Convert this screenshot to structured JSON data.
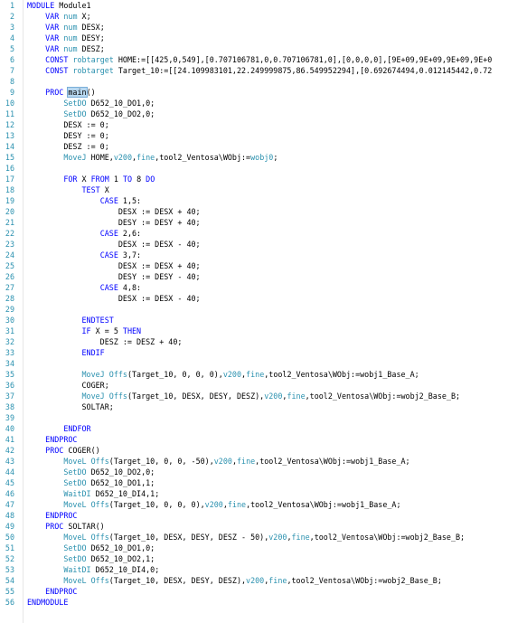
{
  "colors": {
    "background": "#ffffff",
    "line_number": "#2b91af",
    "keyword": "#0000ff",
    "type": "#2b91af",
    "instruction": "#2b91af",
    "plain": "#000000",
    "highlight": "#b8d8f0"
  },
  "lines": [
    {
      "n": "1",
      "tokens": [
        {
          "t": "MODULE",
          "c": "keyword"
        },
        {
          "t": " Module1",
          "c": "plain"
        }
      ]
    },
    {
      "n": "2",
      "tokens": [
        {
          "t": "    ",
          "c": "plain"
        },
        {
          "t": "VAR",
          "c": "keyword"
        },
        {
          "t": " ",
          "c": "plain"
        },
        {
          "t": "num",
          "c": "type"
        },
        {
          "t": " X;",
          "c": "plain"
        }
      ]
    },
    {
      "n": "3",
      "tokens": [
        {
          "t": "    ",
          "c": "plain"
        },
        {
          "t": "VAR",
          "c": "keyword"
        },
        {
          "t": " ",
          "c": "plain"
        },
        {
          "t": "num",
          "c": "type"
        },
        {
          "t": " DESX;",
          "c": "plain"
        }
      ]
    },
    {
      "n": "4",
      "tokens": [
        {
          "t": "    ",
          "c": "plain"
        },
        {
          "t": "VAR",
          "c": "keyword"
        },
        {
          "t": " ",
          "c": "plain"
        },
        {
          "t": "num",
          "c": "type"
        },
        {
          "t": " DESY;",
          "c": "plain"
        }
      ]
    },
    {
      "n": "5",
      "tokens": [
        {
          "t": "    ",
          "c": "plain"
        },
        {
          "t": "VAR",
          "c": "keyword"
        },
        {
          "t": " ",
          "c": "plain"
        },
        {
          "t": "num",
          "c": "type"
        },
        {
          "t": " DESZ;",
          "c": "plain"
        }
      ]
    },
    {
      "n": "6",
      "tokens": [
        {
          "t": "    ",
          "c": "plain"
        },
        {
          "t": "CONST",
          "c": "keyword"
        },
        {
          "t": " ",
          "c": "plain"
        },
        {
          "t": "robtarget",
          "c": "type"
        },
        {
          "t": " HOME:=[[425,0,549],[0.707106781,0,0.707106781,0],[0,0,0,0],[9E+09,9E+09,9E+09,9E+0",
          "c": "plain"
        }
      ]
    },
    {
      "n": "7",
      "tokens": [
        {
          "t": "    ",
          "c": "plain"
        },
        {
          "t": "CONST",
          "c": "keyword"
        },
        {
          "t": " ",
          "c": "plain"
        },
        {
          "t": "robtarget",
          "c": "type"
        },
        {
          "t": " Target_10:=[[24.109983101,22.249999875,86.549952294],[0.692674494,0.012145442,0.72",
          "c": "plain"
        }
      ]
    },
    {
      "n": "8",
      "tokens": []
    },
    {
      "n": "9",
      "tokens": [
        {
          "t": "    ",
          "c": "plain"
        },
        {
          "t": "PROC",
          "c": "keyword"
        },
        {
          "t": " ",
          "c": "plain"
        },
        {
          "t": "main",
          "c": "hl"
        },
        {
          "t": "()",
          "c": "plain"
        }
      ]
    },
    {
      "n": "10",
      "tokens": [
        {
          "t": "        ",
          "c": "plain"
        },
        {
          "t": "SetDO",
          "c": "instr"
        },
        {
          "t": " D652_10_DO1,0;",
          "c": "plain"
        }
      ]
    },
    {
      "n": "11",
      "tokens": [
        {
          "t": "        ",
          "c": "plain"
        },
        {
          "t": "SetDO",
          "c": "instr"
        },
        {
          "t": " D652_10_DO2,0;",
          "c": "plain"
        }
      ]
    },
    {
      "n": "12",
      "tokens": [
        {
          "t": "        DESX := 0;",
          "c": "plain"
        }
      ]
    },
    {
      "n": "13",
      "tokens": [
        {
          "t": "        DESY := 0;",
          "c": "plain"
        }
      ]
    },
    {
      "n": "14",
      "tokens": [
        {
          "t": "        DESZ := 0;",
          "c": "plain"
        }
      ]
    },
    {
      "n": "15",
      "tokens": [
        {
          "t": "        ",
          "c": "plain"
        },
        {
          "t": "MoveJ",
          "c": "instr"
        },
        {
          "t": " HOME,",
          "c": "plain"
        },
        {
          "t": "v200",
          "c": "instr"
        },
        {
          "t": ",",
          "c": "plain"
        },
        {
          "t": "fine",
          "c": "instr"
        },
        {
          "t": ",tool2_Ventosa\\WObj:=",
          "c": "plain"
        },
        {
          "t": "wobj0",
          "c": "instr"
        },
        {
          "t": ";",
          "c": "plain"
        }
      ]
    },
    {
      "n": "16",
      "tokens": []
    },
    {
      "n": "17",
      "tokens": [
        {
          "t": "        ",
          "c": "plain"
        },
        {
          "t": "FOR",
          "c": "keyword"
        },
        {
          "t": " X ",
          "c": "plain"
        },
        {
          "t": "FROM",
          "c": "keyword"
        },
        {
          "t": " 1 ",
          "c": "plain"
        },
        {
          "t": "TO",
          "c": "keyword"
        },
        {
          "t": " 8 ",
          "c": "plain"
        },
        {
          "t": "DO",
          "c": "keyword"
        }
      ]
    },
    {
      "n": "18",
      "tokens": [
        {
          "t": "            ",
          "c": "plain"
        },
        {
          "t": "TEST",
          "c": "keyword"
        },
        {
          "t": " X",
          "c": "plain"
        }
      ]
    },
    {
      "n": "19",
      "tokens": [
        {
          "t": "                ",
          "c": "plain"
        },
        {
          "t": "CASE",
          "c": "keyword"
        },
        {
          "t": " 1,5:",
          "c": "plain"
        }
      ]
    },
    {
      "n": "20",
      "tokens": [
        {
          "t": "                    DESX := DESX + 40;",
          "c": "plain"
        }
      ]
    },
    {
      "n": "21",
      "tokens": [
        {
          "t": "                    DESY := DESY + 40;",
          "c": "plain"
        }
      ]
    },
    {
      "n": "22",
      "tokens": [
        {
          "t": "                ",
          "c": "plain"
        },
        {
          "t": "CASE",
          "c": "keyword"
        },
        {
          "t": " 2,6:",
          "c": "plain"
        }
      ]
    },
    {
      "n": "23",
      "tokens": [
        {
          "t": "                    DESX := DESX - 40;",
          "c": "plain"
        }
      ]
    },
    {
      "n": "24",
      "tokens": [
        {
          "t": "                ",
          "c": "plain"
        },
        {
          "t": "CASE",
          "c": "keyword"
        },
        {
          "t": " 3,7:",
          "c": "plain"
        }
      ]
    },
    {
      "n": "25",
      "tokens": [
        {
          "t": "                    DESX := DESX + 40;",
          "c": "plain"
        }
      ]
    },
    {
      "n": "26",
      "tokens": [
        {
          "t": "                    DESY := DESY - 40;",
          "c": "plain"
        }
      ]
    },
    {
      "n": "27",
      "tokens": [
        {
          "t": "                ",
          "c": "plain"
        },
        {
          "t": "CASE",
          "c": "keyword"
        },
        {
          "t": " 4,8:",
          "c": "plain"
        }
      ]
    },
    {
      "n": "28",
      "tokens": [
        {
          "t": "                    DESX := DESX - 40;",
          "c": "plain"
        }
      ]
    },
    {
      "n": "29",
      "tokens": []
    },
    {
      "n": "30",
      "tokens": [
        {
          "t": "            ",
          "c": "plain"
        },
        {
          "t": "ENDTEST",
          "c": "keyword"
        }
      ]
    },
    {
      "n": "31",
      "tokens": [
        {
          "t": "            ",
          "c": "plain"
        },
        {
          "t": "IF",
          "c": "keyword"
        },
        {
          "t": " X = 5 ",
          "c": "plain"
        },
        {
          "t": "THEN",
          "c": "keyword"
        }
      ]
    },
    {
      "n": "32",
      "tokens": [
        {
          "t": "                DESZ := DESZ + 40;",
          "c": "plain"
        }
      ]
    },
    {
      "n": "33",
      "tokens": [
        {
          "t": "            ",
          "c": "plain"
        },
        {
          "t": "ENDIF",
          "c": "keyword"
        }
      ]
    },
    {
      "n": "34",
      "tokens": []
    },
    {
      "n": "35",
      "tokens": [
        {
          "t": "            ",
          "c": "plain"
        },
        {
          "t": "MoveJ",
          "c": "instr"
        },
        {
          "t": " ",
          "c": "plain"
        },
        {
          "t": "Offs",
          "c": "instr"
        },
        {
          "t": "(Target_10, 0, 0, 0),",
          "c": "plain"
        },
        {
          "t": "v200",
          "c": "instr"
        },
        {
          "t": ",",
          "c": "plain"
        },
        {
          "t": "fine",
          "c": "instr"
        },
        {
          "t": ",tool2_Ventosa\\WObj:=wobj1_Base_A;",
          "c": "plain"
        }
      ]
    },
    {
      "n": "36",
      "tokens": [
        {
          "t": "            COGER;",
          "c": "plain"
        }
      ]
    },
    {
      "n": "37",
      "tokens": [
        {
          "t": "            ",
          "c": "plain"
        },
        {
          "t": "MoveJ",
          "c": "instr"
        },
        {
          "t": " ",
          "c": "plain"
        },
        {
          "t": "Offs",
          "c": "instr"
        },
        {
          "t": "(Target_10, DESX, DESY, DESZ),",
          "c": "plain"
        },
        {
          "t": "v200",
          "c": "instr"
        },
        {
          "t": ",",
          "c": "plain"
        },
        {
          "t": "fine",
          "c": "instr"
        },
        {
          "t": ",tool2_Ventosa\\WObj:=wobj2_Base_B;",
          "c": "plain"
        }
      ]
    },
    {
      "n": "38",
      "tokens": [
        {
          "t": "            SOLTAR;",
          "c": "plain"
        }
      ]
    },
    {
      "n": "39",
      "tokens": []
    },
    {
      "n": "40",
      "tokens": [
        {
          "t": "        ",
          "c": "plain"
        },
        {
          "t": "ENDFOR",
          "c": "keyword"
        }
      ]
    },
    {
      "n": "41",
      "tokens": [
        {
          "t": "    ",
          "c": "plain"
        },
        {
          "t": "ENDPROC",
          "c": "keyword"
        }
      ]
    },
    {
      "n": "42",
      "tokens": [
        {
          "t": "    ",
          "c": "plain"
        },
        {
          "t": "PROC",
          "c": "keyword"
        },
        {
          "t": " COGER()",
          "c": "plain"
        }
      ]
    },
    {
      "n": "43",
      "tokens": [
        {
          "t": "        ",
          "c": "plain"
        },
        {
          "t": "MoveL",
          "c": "instr"
        },
        {
          "t": " ",
          "c": "plain"
        },
        {
          "t": "Offs",
          "c": "instr"
        },
        {
          "t": "(Target_10, 0, 0, -50),",
          "c": "plain"
        },
        {
          "t": "v200",
          "c": "instr"
        },
        {
          "t": ",",
          "c": "plain"
        },
        {
          "t": "fine",
          "c": "instr"
        },
        {
          "t": ",tool2_Ventosa\\WObj:=wobj1_Base_A;",
          "c": "plain"
        }
      ]
    },
    {
      "n": "44",
      "tokens": [
        {
          "t": "        ",
          "c": "plain"
        },
        {
          "t": "SetDO",
          "c": "instr"
        },
        {
          "t": " D652_10_DO2,0;",
          "c": "plain"
        }
      ]
    },
    {
      "n": "45",
      "tokens": [
        {
          "t": "        ",
          "c": "plain"
        },
        {
          "t": "SetDO",
          "c": "instr"
        },
        {
          "t": " D652_10_DO1,1;",
          "c": "plain"
        }
      ]
    },
    {
      "n": "46",
      "tokens": [
        {
          "t": "        ",
          "c": "plain"
        },
        {
          "t": "WaitDI",
          "c": "instr"
        },
        {
          "t": " D652_10_DI4,1;",
          "c": "plain"
        }
      ]
    },
    {
      "n": "47",
      "tokens": [
        {
          "t": "        ",
          "c": "plain"
        },
        {
          "t": "MoveL",
          "c": "instr"
        },
        {
          "t": " ",
          "c": "plain"
        },
        {
          "t": "Offs",
          "c": "instr"
        },
        {
          "t": "(Target_10, 0, 0, 0),",
          "c": "plain"
        },
        {
          "t": "v200",
          "c": "instr"
        },
        {
          "t": ",",
          "c": "plain"
        },
        {
          "t": "fine",
          "c": "instr"
        },
        {
          "t": ",tool2_Ventosa\\WObj:=wobj1_Base_A;",
          "c": "plain"
        }
      ]
    },
    {
      "n": "48",
      "tokens": [
        {
          "t": "    ",
          "c": "plain"
        },
        {
          "t": "ENDPROC",
          "c": "keyword"
        }
      ]
    },
    {
      "n": "49",
      "tokens": [
        {
          "t": "    ",
          "c": "plain"
        },
        {
          "t": "PROC",
          "c": "keyword"
        },
        {
          "t": " SOLTAR()",
          "c": "plain"
        }
      ]
    },
    {
      "n": "50",
      "tokens": [
        {
          "t": "        ",
          "c": "plain"
        },
        {
          "t": "MoveL",
          "c": "instr"
        },
        {
          "t": " ",
          "c": "plain"
        },
        {
          "t": "Offs",
          "c": "instr"
        },
        {
          "t": "(Target_10, DESX, DESY, DESZ - 50),",
          "c": "plain"
        },
        {
          "t": "v200",
          "c": "instr"
        },
        {
          "t": ",",
          "c": "plain"
        },
        {
          "t": "fine",
          "c": "instr"
        },
        {
          "t": ",tool2_Ventosa\\WObj:=wobj2_Base_B;",
          "c": "plain"
        }
      ]
    },
    {
      "n": "51",
      "tokens": [
        {
          "t": "        ",
          "c": "plain"
        },
        {
          "t": "SetDO",
          "c": "instr"
        },
        {
          "t": " D652_10_DO1,0;",
          "c": "plain"
        }
      ]
    },
    {
      "n": "52",
      "tokens": [
        {
          "t": "        ",
          "c": "plain"
        },
        {
          "t": "SetDO",
          "c": "instr"
        },
        {
          "t": " D652_10_DO2,1;",
          "c": "plain"
        }
      ]
    },
    {
      "n": "53",
      "tokens": [
        {
          "t": "        ",
          "c": "plain"
        },
        {
          "t": "WaitDI",
          "c": "instr"
        },
        {
          "t": " D652_10_DI4,0;",
          "c": "plain"
        }
      ]
    },
    {
      "n": "54",
      "tokens": [
        {
          "t": "        ",
          "c": "plain"
        },
        {
          "t": "MoveL",
          "c": "instr"
        },
        {
          "t": " ",
          "c": "plain"
        },
        {
          "t": "Offs",
          "c": "instr"
        },
        {
          "t": "(Target_10, DESX, DESY, DESZ),",
          "c": "plain"
        },
        {
          "t": "v200",
          "c": "instr"
        },
        {
          "t": ",",
          "c": "plain"
        },
        {
          "t": "fine",
          "c": "instr"
        },
        {
          "t": ",tool2_Ventosa\\WObj:=wobj2_Base_B;",
          "c": "plain"
        }
      ]
    },
    {
      "n": "55",
      "tokens": [
        {
          "t": "    ",
          "c": "plain"
        },
        {
          "t": "ENDPROC",
          "c": "keyword"
        }
      ]
    },
    {
      "n": "56",
      "tokens": [
        {
          "t": "ENDMODULE",
          "c": "keyword"
        }
      ]
    }
  ]
}
